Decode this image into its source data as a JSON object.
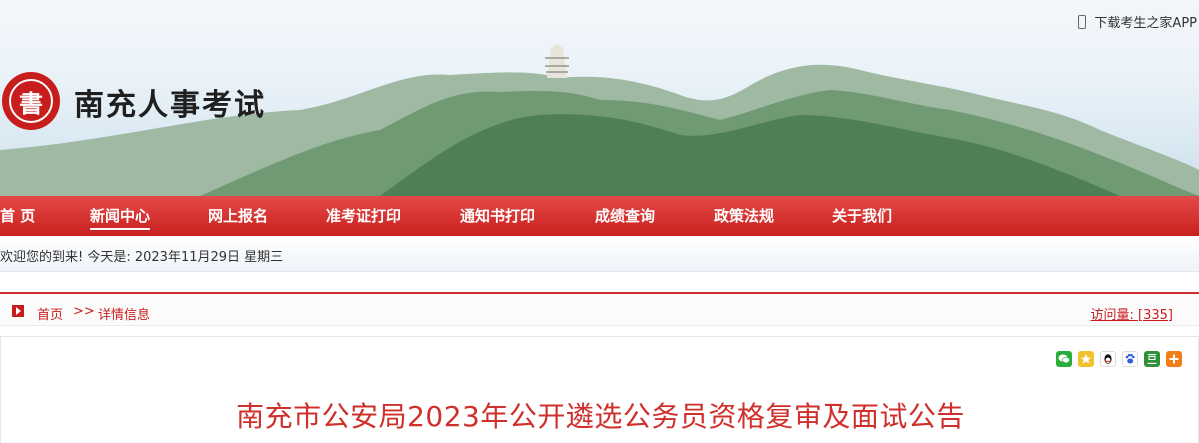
{
  "header": {
    "logo_glyph": "書",
    "site_title": "南充人事考试",
    "app_link_label": "下载考生之家APP"
  },
  "nav": {
    "items": [
      {
        "label": "首 页"
      },
      {
        "label": "新闻中心"
      },
      {
        "label": "网上报名"
      },
      {
        "label": "准考证打印"
      },
      {
        "label": "通知书打印"
      },
      {
        "label": "成绩查询"
      },
      {
        "label": "政策法规"
      },
      {
        "label": "关于我们"
      }
    ],
    "active": "新闻中心"
  },
  "welcome": {
    "text": "欢迎您的到来!  今天是: 2023年11月29日 星期三"
  },
  "breadcrumb": {
    "home": "首页",
    "separator": ">>",
    "current": "详情信息",
    "visits": "访问量: [335]"
  },
  "share": {
    "icons": [
      "wechat-icon",
      "qzone-icon",
      "qq-icon",
      "baidu-icon",
      "douban-icon",
      "more-icon"
    ]
  },
  "article": {
    "title": "南充市公安局2023年公开遴选公务员资格复审及面试公告"
  },
  "colors": {
    "brand_red": "#c81d1d",
    "nav_red": "#d0302b",
    "title_red": "#d0302b"
  }
}
